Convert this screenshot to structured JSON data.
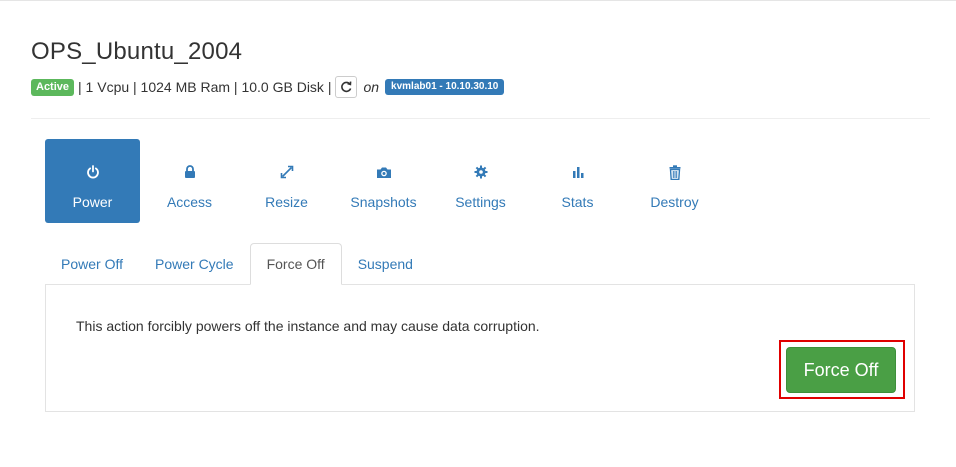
{
  "server": {
    "name": "OPS_Ubuntu_2004",
    "status": "Active",
    "specs": "| 1 Vcpu | 1024 MB Ram | 10.0 GB Disk |",
    "on_label": "on",
    "host": "kvmlab01 - 10.10.30.10",
    "refresh_icon": "refresh-icon"
  },
  "actions": [
    {
      "label": "Power",
      "icon": "power-icon"
    },
    {
      "label": "Access",
      "icon": "lock-icon"
    },
    {
      "label": "Resize",
      "icon": "resize-icon"
    },
    {
      "label": "Snapshots",
      "icon": "camera-icon"
    },
    {
      "label": "Settings",
      "icon": "gear-icon"
    },
    {
      "label": "Stats",
      "icon": "bar-chart-icon"
    },
    {
      "label": "Destroy",
      "icon": "trash-icon"
    }
  ],
  "tabs": [
    {
      "label": "Power Off"
    },
    {
      "label": "Power Cycle"
    },
    {
      "label": "Force Off"
    },
    {
      "label": "Suspend"
    }
  ],
  "panel": {
    "message": "This action forcibly powers off the instance and may cause data corruption.",
    "button_label": "Force Off"
  },
  "colors": {
    "primary": "#337ab7",
    "success": "#5cb85c",
    "button_green": "#4a9f45",
    "highlight": "#e00000"
  }
}
